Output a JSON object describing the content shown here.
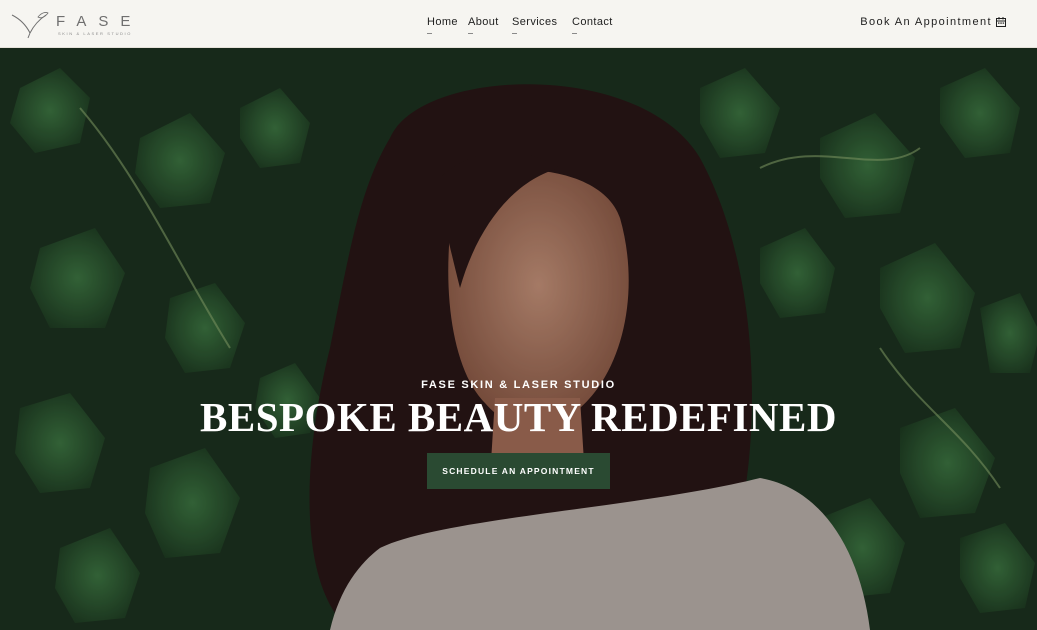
{
  "brand": {
    "wordmark": "FASE",
    "tagline": "SKIN & LASER STUDIO",
    "color": "#6f6f6f"
  },
  "nav": {
    "items": [
      {
        "label": "Home"
      },
      {
        "label": "About"
      },
      {
        "label": "Services"
      },
      {
        "label": "Contact"
      }
    ],
    "book_label": "Book An Appointment",
    "book_icon": "calendar-icon"
  },
  "hero": {
    "eyebrow": "FASE SKIN & LASER STUDIO",
    "headline": "BESPOKE BEAUTY REDEFINED",
    "cta_label": "SCHEDULE AN APPOINTMENT",
    "cta_color": "#2a4a32",
    "image_alt": "woman with long dark hair in front of green ivy"
  },
  "colors": {
    "header_bg": "#f6f5f1",
    "foliage": "#2f5a34",
    "text_dark": "#1f1f1f"
  }
}
